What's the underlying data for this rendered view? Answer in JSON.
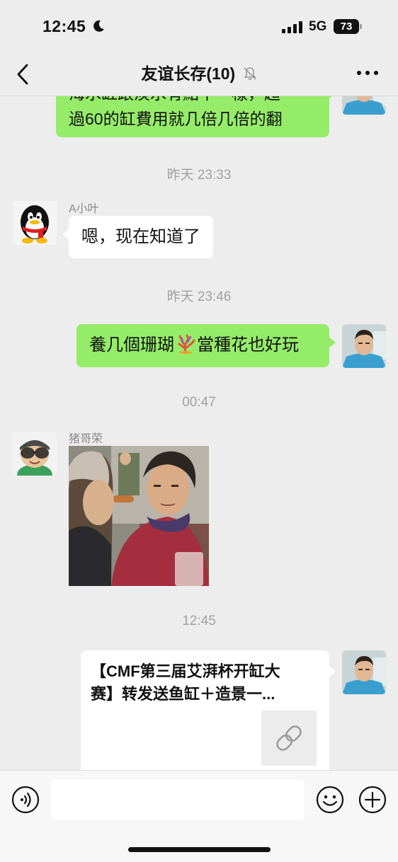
{
  "status_bar": {
    "time": "12:45",
    "network": "5G",
    "battery": "73"
  },
  "nav": {
    "title": "友谊长存(10)"
  },
  "icons": {
    "back": "chevron-left-icon",
    "mute": "bell-off-icon",
    "more": "ellipsis-icon",
    "coral": "coral-emoji-icon",
    "link": "link-icon",
    "voice": "voice-icon",
    "emoji": "smiley-icon",
    "plus": "plus-circle-icon",
    "moon": "moon-icon"
  },
  "colors": {
    "my_bubble": "#95ec69",
    "other_bubble": "#ffffff",
    "background": "#ededed"
  },
  "messages": {
    "m1": {
      "line1": "海水缸跟淡水有點不一樣，超",
      "line2": "過60的缸費用就几倍几倍的翻"
    },
    "t1": "昨天 23:33",
    "m2": {
      "sender": "A小叶",
      "text": "嗯，现在知道了"
    },
    "t2": "昨天 23:46",
    "m3": {
      "text_before": "養几個珊瑚",
      "text_after": "當種花也好玩"
    },
    "t3": "00:47",
    "m4": {
      "sender": "猪哥荣"
    },
    "t4": "12:45",
    "m5": {
      "line1": "【CMF第三届艾湃杯开缸大",
      "line2": "赛】转发送鱼缸＋造景一..."
    }
  }
}
